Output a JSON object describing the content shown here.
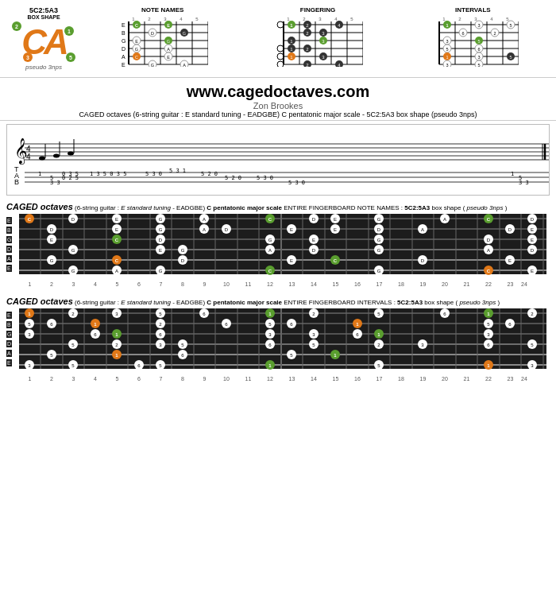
{
  "header": {
    "box_shape": "5C2:5A3",
    "box_shape_sub": "BOX SHAPE",
    "pseudo": "pseudo 3nps",
    "logo_letters": "CA",
    "dot1": "2",
    "dot2": "1",
    "dot3": "3",
    "dot4": "5"
  },
  "diagrams": {
    "note_names_title": "NOTE NAMES",
    "fingering_title": "FINGERING",
    "intervals_title": "INTERVALS"
  },
  "website": {
    "url": "www.cagedoctaves.com",
    "author": "Zon Brookes",
    "description": "CAGED octaves (6-string guitar : E standard tuning - EADGBE) C pentatonic major scale - 5C2:5A3 box shape (pseudo 3nps)"
  },
  "fingerboard1": {
    "title_caged": "CAGED octaves",
    "title_rest": " (6-string guitar : ",
    "title_tuning": "E standard tuning",
    "title_rest2": " - EADGBE) ",
    "title_scale": "C pentatonic major scale",
    "title_rest3": " ENTIRE FINGERBOARD NOTE NAMES : ",
    "title_box": "5C2:5A3",
    "title_rest4": " box shape (",
    "title_pseudo": "pseudo 3nps",
    "title_rest5": ")"
  },
  "fingerboard2": {
    "title_caged": "CAGED octaves",
    "title_rest": " (6-string guitar : ",
    "title_tuning": "E standard tuning",
    "title_rest2": " - EADGBE) ",
    "title_scale": "C pentatonic major scale",
    "title_rest3": " ENTIRE FINGERBOARD INTERVALS : ",
    "title_box": "5C2:5A3",
    "title_rest4": " box shape (",
    "title_pseudo": "pseudo 3nps",
    "title_rest5": ")"
  },
  "fret_numbers": [
    "1",
    "2",
    "3",
    "4",
    "5",
    "6",
    "7",
    "8",
    "9",
    "10",
    "11",
    "12",
    "13",
    "14",
    "15",
    "16",
    "17",
    "18",
    "19",
    "20",
    "21",
    "22",
    "23",
    "24"
  ],
  "strings": [
    "E",
    "B",
    "G",
    "D",
    "A",
    "E"
  ],
  "colors": {
    "green": "#5a9e2f",
    "orange": "#e07818",
    "white": "#ffffff",
    "black_text": "#000000"
  }
}
